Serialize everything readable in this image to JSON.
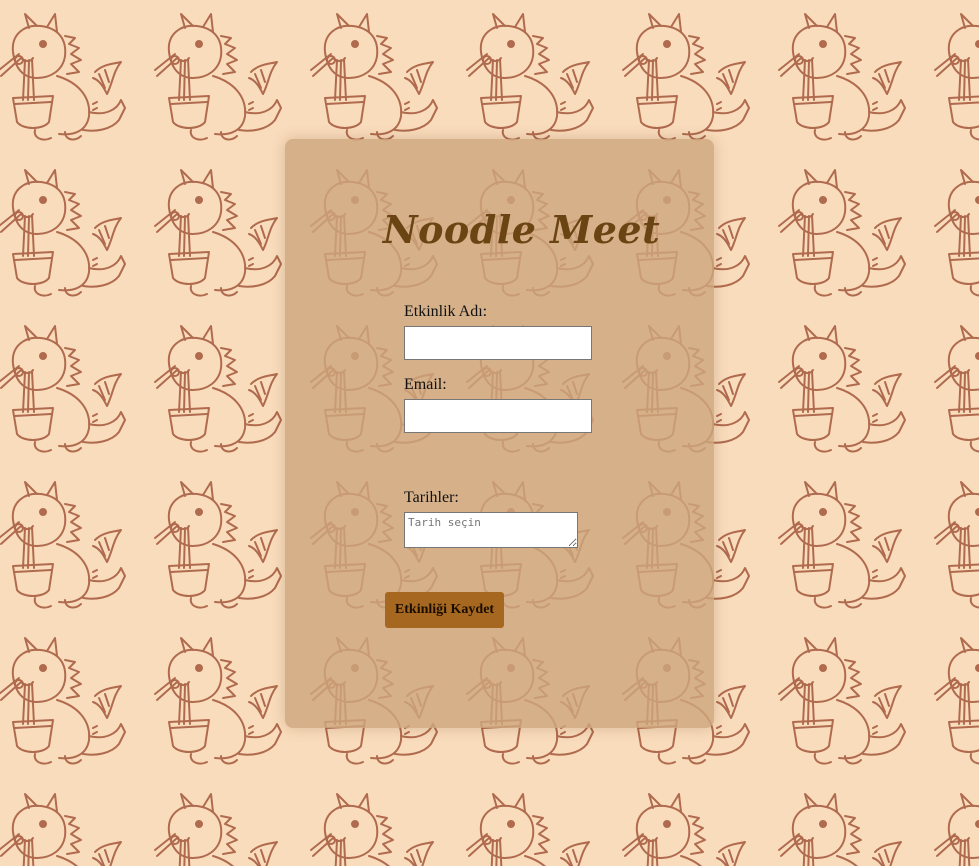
{
  "app": {
    "title": "Noodle Meet"
  },
  "form": {
    "event_name_label": "Etkinlik Adı:",
    "event_name_value": "",
    "email_label": "Email:",
    "email_value": "",
    "dates_label": "Tarihler:",
    "dates_placeholder": "Tarih seçin",
    "submit_label": "Etkinliği Kaydet"
  },
  "colors": {
    "background": "#f9dcbc",
    "pattern_stroke": "#b06a4e",
    "card": "#d4ae88",
    "title": "#6b4413",
    "button": "#a66820"
  },
  "icons": {
    "background_pattern": "noodle-dragon-icon"
  }
}
